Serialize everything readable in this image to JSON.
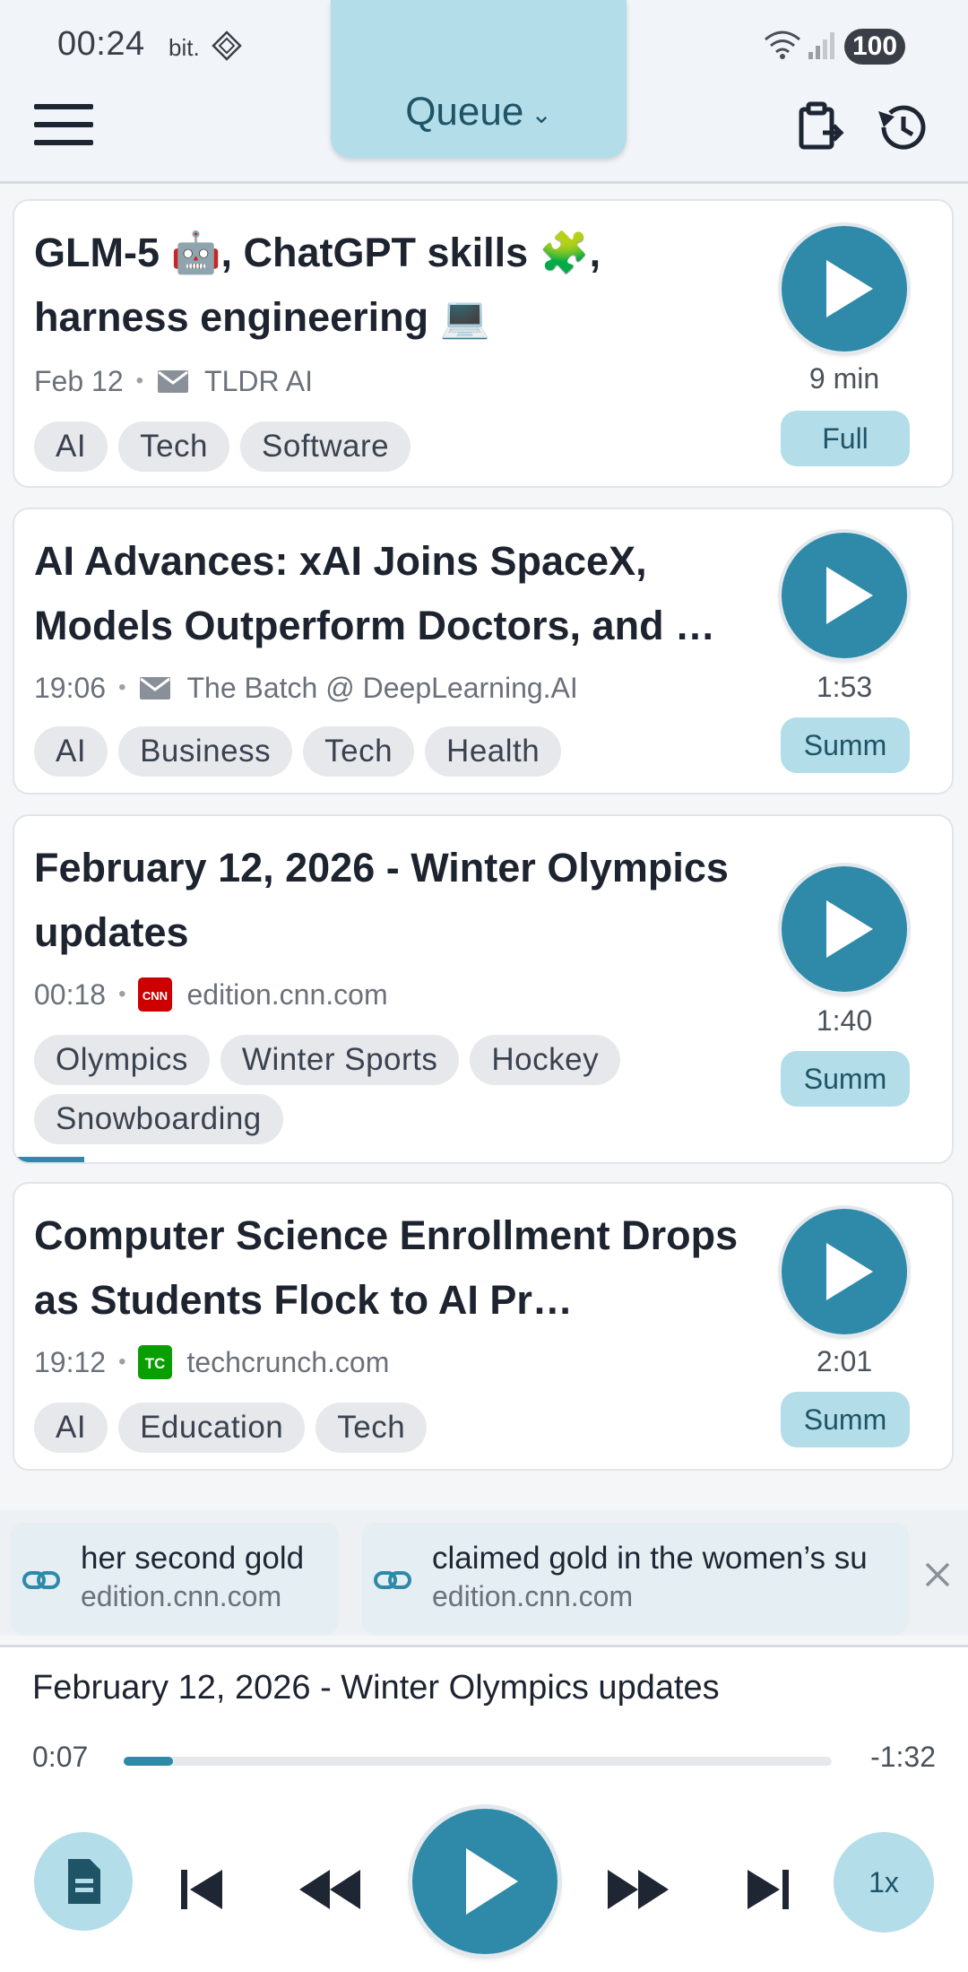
{
  "status_bar": {
    "time": "00:24",
    "carrier": "bit.",
    "battery": "100"
  },
  "header": {
    "queue_label": "Queue"
  },
  "cards": [
    {
      "title": "GLM-5 🤖, ChatGPT skills 🧩, harness engineering 💻",
      "date": "Feb 12",
      "source": "TLDR AI",
      "source_icon": "mail-icon",
      "tags": [
        "AI",
        "Tech",
        "Software"
      ],
      "duration": "9 min",
      "mode": "Full"
    },
    {
      "title": "AI Advances: xAI Joins SpaceX, Models Outperform Doctors, and …",
      "date": "19:06",
      "source": "The Batch @ DeepLearning.AI",
      "source_icon": "mail-icon",
      "tags": [
        "AI",
        "Business",
        "Tech",
        "Health"
      ],
      "duration": "1:53",
      "mode": "Summ"
    },
    {
      "title": "February 12, 2026 - Winter Olympics updates",
      "date": "00:18",
      "source": "edition.cnn.com",
      "source_icon": "cnn-logo",
      "tags": [
        "Olympics",
        "Winter Sports",
        "Hockey",
        "Snowboarding"
      ],
      "duration": "1:40",
      "mode": "Summ"
    },
    {
      "title": "Computer Science Enrollment Drops as Students Flock to AI Pr…",
      "date": "19:12",
      "source": "techcrunch.com",
      "source_icon": "techcrunch-logo",
      "tags": [
        "AI",
        "Education",
        "Tech"
      ],
      "duration": "2:01",
      "mode": "Summ"
    }
  ],
  "highlights": [
    {
      "text": "her second gold",
      "source": "edition.cnn.com"
    },
    {
      "text": "claimed gold in the women’s su",
      "source": "edition.cnn.com"
    }
  ],
  "player": {
    "now_playing": "February 12, 2026 - Winter Olympics updates",
    "current_time": "0:07",
    "remaining_time": "-1:32",
    "progress": 0.07,
    "speed": "1x"
  },
  "colors": {
    "accent": "#2e8aa8",
    "accent_light": "#b3dde9",
    "cnn_red": "#cc0000",
    "tc_green": "#0a9e01"
  }
}
